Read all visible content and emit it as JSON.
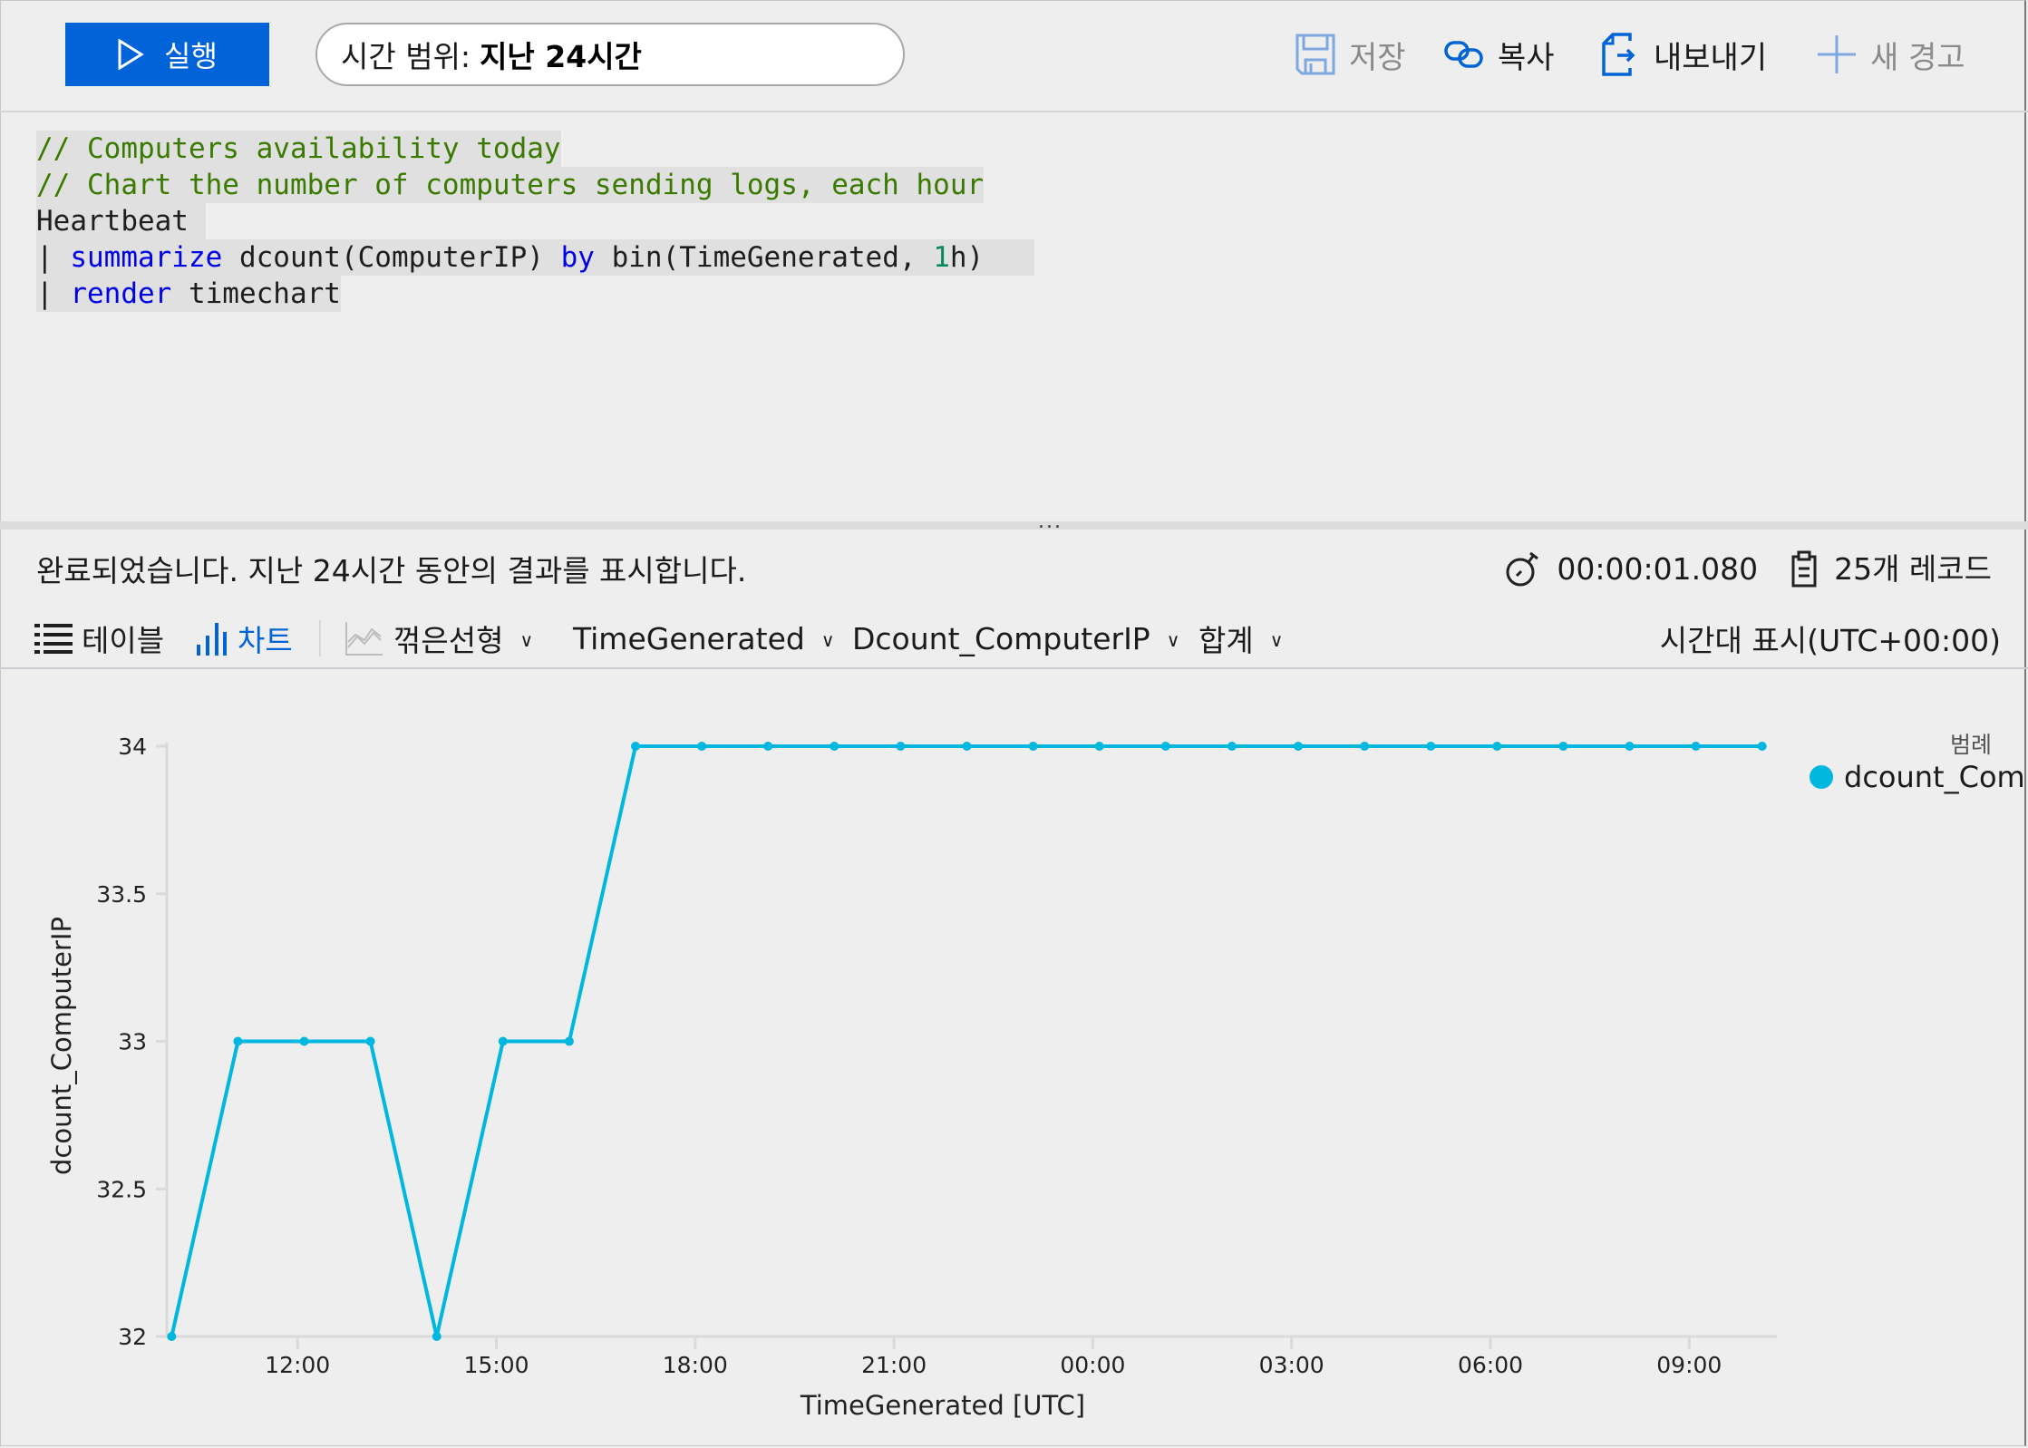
{
  "toolbar": {
    "run_label": "실행",
    "time_range_label": "시간 범위:",
    "time_range_value": "지난 24시간",
    "save_label": "저장",
    "copy_label": "복사",
    "export_label": "내보내기",
    "new_alert_label": "새 경고",
    "icons": {
      "run": "play-icon",
      "save": "save-icon",
      "copy": "link-icon",
      "export": "export-icon",
      "new_alert": "plus-icon"
    }
  },
  "editor": {
    "lines": [
      [
        {
          "t": "// Computers availability today",
          "k": "comment"
        }
      ],
      [
        {
          "t": "// Chart the number of computers sending logs, each hour",
          "k": "comment"
        }
      ],
      [
        {
          "t": "Heartbeat ",
          "k": "plain"
        }
      ],
      [
        {
          "t": "| ",
          "k": "pipe"
        },
        {
          "t": "summarize",
          "k": "keyword"
        },
        {
          "t": " dcount(ComputerIP) ",
          "k": "plain"
        },
        {
          "t": "by",
          "k": "keyword"
        },
        {
          "t": " bin(TimeGenerated, ",
          "k": "plain"
        },
        {
          "t": "1",
          "k": "number"
        },
        {
          "t": "h)   ",
          "k": "plain"
        }
      ],
      [
        {
          "t": "| ",
          "k": "pipe"
        },
        {
          "t": "render",
          "k": "keyword"
        },
        {
          "t": " timechart",
          "k": "plain"
        }
      ]
    ]
  },
  "splitter": {
    "handle": "..."
  },
  "status": {
    "message": "완료되었습니다. 지난 24시간 동안의 결과를 표시합니다.",
    "duration": "00:00:01.080",
    "records": "25개 레코드"
  },
  "chart_toolbar": {
    "table_label": "테이블",
    "chart_label": "차트",
    "chart_type": "꺾은선형",
    "x_column": "TimeGenerated",
    "y_column": "Dcount_ComputerIP",
    "aggregation": "합계",
    "timezone": "시간대 표시(UTC+00:00)",
    "accent_color": "#0063d8"
  },
  "chart_data": {
    "type": "line",
    "title": "",
    "xlabel": "TimeGenerated [UTC]",
    "ylabel": "dcount_ComputerIP",
    "x_tick_labels": [
      "12:00",
      "15:00",
      "18:00",
      "21:00",
      "00:00",
      "03:00",
      "06:00",
      "09:00"
    ],
    "x_ticks_hours": [
      12,
      15,
      18,
      21,
      24,
      27,
      30,
      33
    ],
    "x_hours_range": [
      10,
      34
    ],
    "y_tick_labels": [
      "34",
      "33.5",
      "33",
      "32.5",
      "32"
    ],
    "y_ticks": [
      34,
      33.5,
      33,
      32.5,
      32
    ],
    "ylim": [
      32,
      34
    ],
    "grid": false,
    "legend_title": "범례",
    "legend_position": "top-right",
    "series": [
      {
        "name": "dcount_ComputerIP",
        "color": "#00b7e0",
        "x": [
          "10:00",
          "11:00",
          "12:00",
          "13:00",
          "14:00",
          "15:00",
          "16:00",
          "17:00",
          "18:00",
          "19:00",
          "20:00",
          "21:00",
          "22:00",
          "23:00",
          "00:00",
          "01:00",
          "02:00",
          "03:00",
          "04:00",
          "05:00",
          "06:00",
          "07:00",
          "08:00",
          "09:00",
          "10:00"
        ],
        "values": [
          32,
          33,
          33,
          33,
          32,
          33,
          33,
          34,
          34,
          34,
          34,
          34,
          34,
          34,
          34,
          34,
          34,
          34,
          34,
          34,
          34,
          34,
          34,
          34,
          34
        ]
      }
    ]
  }
}
